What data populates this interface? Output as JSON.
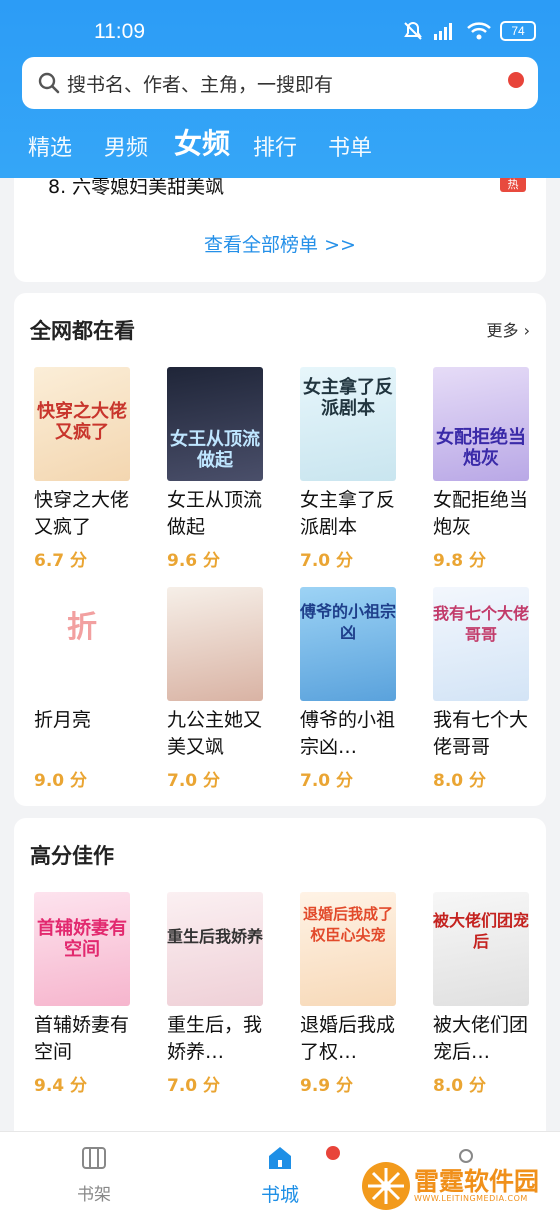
{
  "status": {
    "time": "11:09",
    "battery": "74"
  },
  "search": {
    "placeholder": "搜书名、作者、主角，一搜即有"
  },
  "tabs": [
    "精选",
    "男频",
    "女频",
    "排行",
    "书单"
  ],
  "rank": {
    "partial_row": "8.  六零媳妇美甜美飒",
    "badge": "热",
    "view_all": "查看全部榜单 >>"
  },
  "section1": {
    "title": "全网都在看",
    "more": "更多",
    "books": [
      {
        "title": "快穿之大佬又疯了",
        "score": "6.7 分",
        "cover_text": "快穿之大佬又疯了",
        "color": "#f6e4c6"
      },
      {
        "title": "女王从顶流做起",
        "score": "9.6 分",
        "cover_text": "女王从顶流做起",
        "color": "#2e3548"
      },
      {
        "title": "女主拿了反派剧本",
        "score": "7.0 分",
        "cover_text": "女主拿了反派剧本",
        "color": "#d8ecf3"
      },
      {
        "title": "女配拒绝当炮灰",
        "score": "9.8 分",
        "cover_text": "女配拒绝当炮灰",
        "color": "#d4c9ee"
      },
      {
        "title": "折月亮",
        "score": "9.0 分",
        "cover_text": "折",
        "color": "#ffffff"
      },
      {
        "title": "九公主她又美又飒",
        "score": "7.0 分",
        "cover_text": "",
        "color": "#efe6df"
      },
      {
        "title": "傅爷的小祖宗凶…",
        "score": "7.0 分",
        "cover_text": "傅爷的小祖宗凶",
        "color": "#8ec6ef"
      },
      {
        "title": "我有七个大佬哥哥",
        "score": "8.0 分",
        "cover_text": "我有七个大佬哥哥",
        "color": "#e9f2fb"
      }
    ]
  },
  "section2": {
    "title": "高分佳作",
    "books": [
      {
        "title": "首辅娇妻有空间",
        "score": "9.4 分",
        "cover_text": "首辅娇妻有空间",
        "color": "#fbd8e5"
      },
      {
        "title": "重生后，我娇养…",
        "score": "7.0 分",
        "cover_text": "重生后我娇养",
        "color": "#f7e9ec"
      },
      {
        "title": "退婚后我成了权…",
        "score": "9.9 分",
        "cover_text": "退婚后我成了权臣心尖宠",
        "color": "#fdf0e2"
      },
      {
        "title": "被大佬们团宠后…",
        "score": "8.0 分",
        "cover_text": "被大佬们团宠后",
        "color": "#f4f4f4"
      }
    ]
  },
  "nav": {
    "shelf": "书架",
    "store": "书城"
  },
  "watermark": {
    "name": "雷霆软件园",
    "url": "WWW.LEITINGMEDIA.COM"
  },
  "colors": {
    "accent": "#2c9cf6",
    "score": "#eaa533",
    "badge": "#e8443a"
  }
}
